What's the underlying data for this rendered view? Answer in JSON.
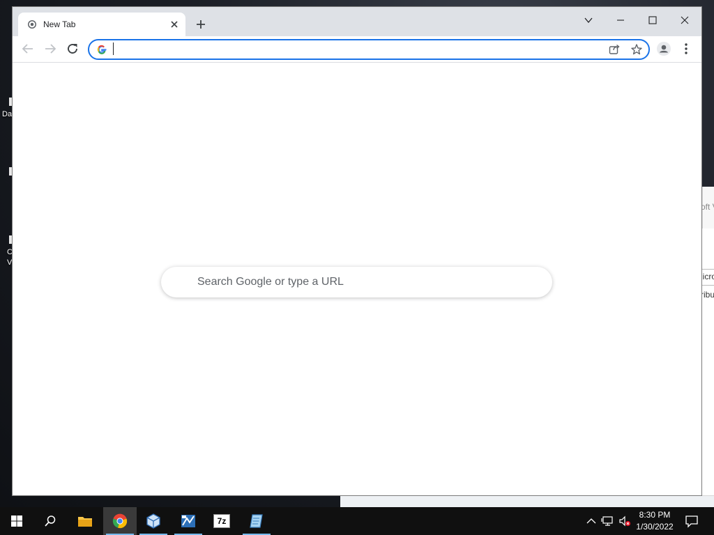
{
  "desktop": {
    "fragments": [
      "Da",
      "C",
      "V"
    ]
  },
  "background_window": {
    "text_fragments": [
      "oft V",
      "licro",
      "ribu"
    ]
  },
  "browser": {
    "tab": {
      "title": "New Tab"
    },
    "omnibox": {
      "value": "",
      "placeholder": ""
    },
    "new_tab_page": {
      "search_placeholder": "Search Google or type a URL"
    },
    "colors": {
      "accent": "#1a73e8",
      "tabstrip": "#dee1e6"
    }
  },
  "taskbar": {
    "apps": [
      "start-icon",
      "search-icon",
      "file-explorer-icon",
      "chrome-icon",
      "virtualbox-icon",
      "network-app-icon",
      "7zip-icon",
      "notepad-icon"
    ],
    "seven_zip_label": "7z",
    "clock": {
      "time": "8:30 PM",
      "date": "1/30/2022"
    }
  }
}
